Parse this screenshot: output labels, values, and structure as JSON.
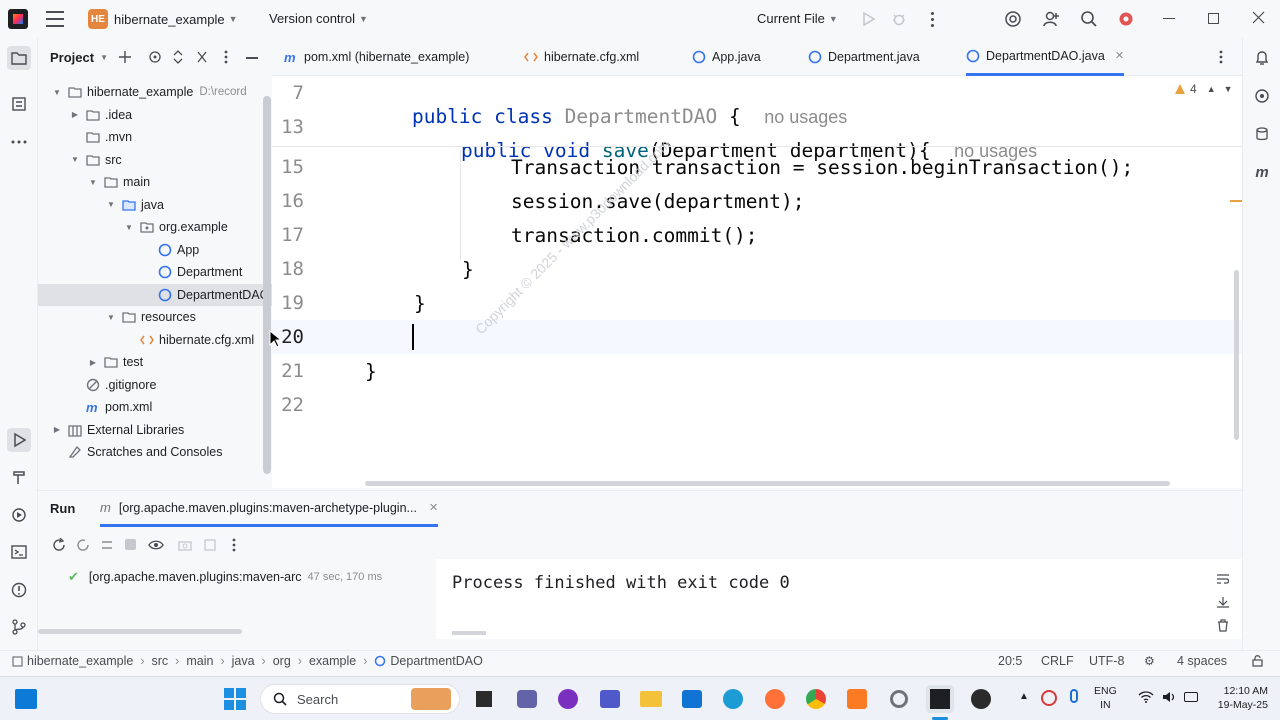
{
  "titlebar": {
    "project_badge": "HE",
    "project_name": "hibernate_example",
    "vcs_label": "Version control",
    "run_config": "Current File"
  },
  "project_panel": {
    "title": "Project",
    "tree": [
      {
        "label": "hibernate_example",
        "suffix": "D:\\record",
        "depth": 0,
        "arrow": "down",
        "icon": "folder"
      },
      {
        "label": ".idea",
        "depth": 1,
        "arrow": "right",
        "icon": "folder"
      },
      {
        "label": ".mvn",
        "depth": 1,
        "arrow": "none",
        "icon": "folder"
      },
      {
        "label": "src",
        "depth": 1,
        "arrow": "down",
        "icon": "folder"
      },
      {
        "label": "main",
        "depth": 2,
        "arrow": "down",
        "icon": "folder"
      },
      {
        "label": "java",
        "depth": 3,
        "arrow": "down",
        "icon": "folder-blue"
      },
      {
        "label": "org.example",
        "depth": 4,
        "arrow": "down",
        "icon": "package"
      },
      {
        "label": "App",
        "depth": 5,
        "arrow": "none",
        "icon": "class"
      },
      {
        "label": "Department",
        "depth": 5,
        "arrow": "none",
        "icon": "class"
      },
      {
        "label": "DepartmentDAO",
        "depth": 5,
        "arrow": "none",
        "icon": "class",
        "selected": true
      },
      {
        "label": "resources",
        "depth": 3,
        "arrow": "down",
        "icon": "folder-res"
      },
      {
        "label": "hibernate.cfg.xml",
        "depth": 4,
        "arrow": "none",
        "icon": "xml"
      },
      {
        "label": "test",
        "depth": 2,
        "arrow": "right",
        "icon": "folder"
      },
      {
        "label": ".gitignore",
        "depth": 1,
        "arrow": "none",
        "icon": "gitignore"
      },
      {
        "label": "pom.xml",
        "depth": 1,
        "arrow": "none",
        "icon": "maven"
      },
      {
        "label": "External Libraries",
        "depth": 0,
        "arrow": "right",
        "icon": "libs"
      },
      {
        "label": "Scratches and Consoles",
        "depth": 0,
        "arrow": "none",
        "icon": "scratch"
      }
    ]
  },
  "tabs": [
    {
      "label": "pom.xml (hibernate_example)",
      "icon": "maven"
    },
    {
      "label": "hibernate.cfg.xml",
      "icon": "xml"
    },
    {
      "label": "App.java",
      "icon": "class"
    },
    {
      "label": "Department.java",
      "icon": "class"
    },
    {
      "label": "DepartmentDAO.java",
      "icon": "class",
      "active": true
    }
  ],
  "editor": {
    "warnings_count": "4",
    "sticky": [
      {
        "line": "7",
        "kw": "public class",
        "name": "DepartmentDAO",
        "rest": " {",
        "hint": "no usages"
      },
      {
        "line": "13",
        "kw": "public void",
        "name": "save",
        "rest": "(Department department){",
        "hint": "no usages"
      }
    ],
    "lines": [
      {
        "n": "15",
        "text": "Transaction transaction = session.beginTransaction();"
      },
      {
        "n": "16",
        "text": "session.save(department);"
      },
      {
        "n": "17",
        "text": "transaction.commit();"
      },
      {
        "n": "18",
        "text": "}"
      },
      {
        "n": "19",
        "text": "}"
      },
      {
        "n": "20",
        "text": ""
      },
      {
        "n": "21",
        "text": "}"
      },
      {
        "n": "22",
        "text": ""
      }
    ],
    "watermark": "Copyright © 2025 - www.p30download.com"
  },
  "run_panel": {
    "title": "Run",
    "tab_label": "[org.apache.maven.plugins:maven-archetype-plugin...",
    "tree_item": "[org.apache.maven.plugins:maven-arc",
    "tree_time": "47 sec, 170 ms",
    "console_text": "Process finished with exit code 0"
  },
  "statusbar": {
    "breadcrumb": [
      "hibernate_example",
      "src",
      "main",
      "java",
      "org",
      "example",
      "DepartmentDAO"
    ],
    "position": "20:5",
    "line_sep": "CRLF",
    "encoding": "UTF-8",
    "indent": "4 spaces"
  },
  "taskbar": {
    "search": "Search",
    "lang1": "ENG",
    "lang2": "IN",
    "time": "12:10 AM",
    "date": "19-May-25"
  },
  "colors": {
    "accent": "#3574f0",
    "keyword": "#0033b3",
    "method": "#00627a",
    "badge": "#e5863f"
  }
}
